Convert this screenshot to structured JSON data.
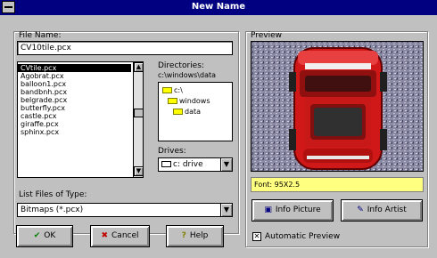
{
  "window": {
    "title": "New Name"
  },
  "file_name": {
    "label": "File Name:",
    "value": "CV10tile.pcx"
  },
  "files": [
    "CVtile.pcx",
    "Agobrat.pcx",
    "balloon1.pcx",
    "bandbnh.pcx",
    "belgrade.pcx",
    "butterfly.pcx",
    "castle.pcx",
    "giraffe.pcx",
    "sphinx.pcx"
  ],
  "directories": {
    "label": "Directories:",
    "path": "c:\\windows\\data",
    "items": [
      "c:\\",
      "windows",
      "data"
    ]
  },
  "drives": {
    "label": "Drives:",
    "value": "c: drive"
  },
  "file_type": {
    "label": "List Files of Type:",
    "value": "Bitmaps (*.pcx)"
  },
  "buttons": {
    "ok": "OK",
    "cancel": "Cancel",
    "help": "Help",
    "info_picture": "Info Picture",
    "info_artist": "Info Artist"
  },
  "preview": {
    "label": "Preview",
    "status": "Font: 95X2.5"
  },
  "auto_preview": {
    "label": "Automatic Preview",
    "checked": true
  },
  "colors": {
    "titlebar": "#000080",
    "dialog": "#c0c0c0",
    "status": "#ffff80"
  }
}
